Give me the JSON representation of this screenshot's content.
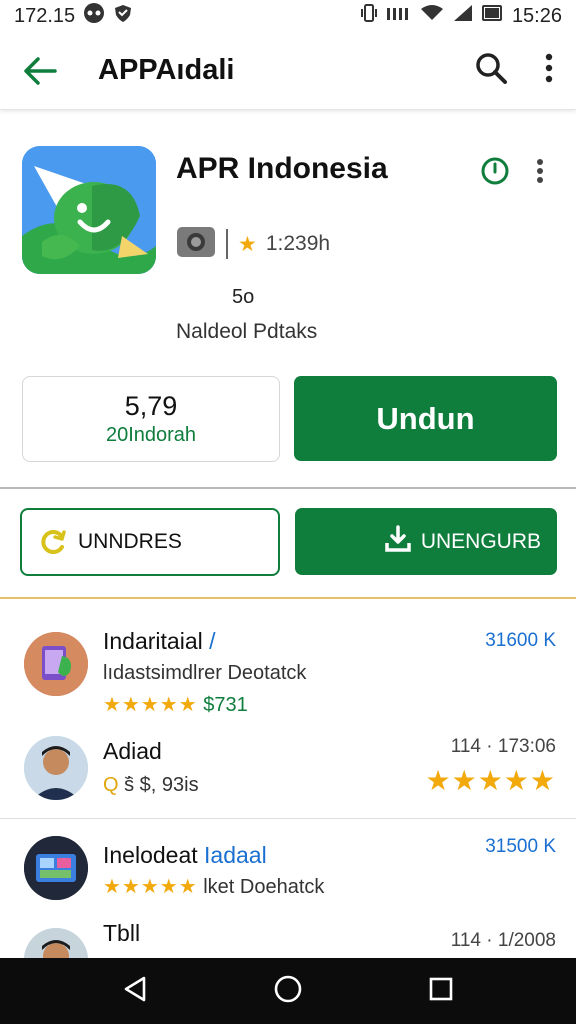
{
  "status_bar": {
    "time_left": "172.15",
    "time_right": "15:26"
  },
  "app_bar": {
    "title": "APPAıdali"
  },
  "app": {
    "name": "APR Indonesia",
    "rating_text": "1:239h",
    "age_rating": "5o",
    "developer": "Naldeol Pdtaks"
  },
  "price_box": {
    "price": "5,79",
    "downloads": "20Indorah"
  },
  "install_label": "Undun",
  "undo_label": "UNNDRES",
  "update_label": "UNENGURB",
  "list": [
    {
      "title": "Indaritaial",
      "title_suffix": "/",
      "subtitle": "lıdastsimdlrer Deotatck",
      "stars": "★★★★★",
      "rating_detail": "$731",
      "right": "31600 K"
    },
    {
      "title": "Adiad",
      "subtitle_prefix": "Q",
      "subtitle": "ṡ᷈ $, 93is",
      "right": "114 · 173:06",
      "stars": "★★★★★"
    },
    {
      "title": "Inelodeat",
      "title_suffix": "Iadaal",
      "stars": "★★★★★",
      "subtitle": "lket Doehatck",
      "right": "31500 K"
    },
    {
      "title": "Tbll",
      "right": "114 · 1/2008"
    }
  ],
  "colors": {
    "accent_green": "#0f7d3c",
    "link_blue": "#1a6fd0",
    "star_gold": "#f2a90c"
  },
  "icons": [
    "back-arrow-icon",
    "search-icon",
    "more-vert-icon",
    "timer-icon",
    "camera-icon",
    "star-icon",
    "refresh-icon",
    "download-icon",
    "nav-back-icon",
    "nav-home-icon",
    "nav-recents-icon"
  ]
}
